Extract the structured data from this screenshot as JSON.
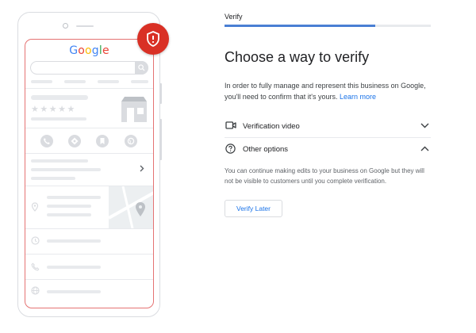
{
  "colors": {
    "accent": "#1a73e8",
    "progress": "#4a7fd4",
    "alert": "#d93025",
    "frame_highlight": "#e57373"
  },
  "illustration": {
    "brand": [
      "G",
      "o",
      "o",
      "g",
      "l",
      "e"
    ],
    "brand_colors": [
      "#4285f4",
      "#ea4335",
      "#fbbc05",
      "#4285f4",
      "#34a853",
      "#ea4335"
    ],
    "stars": "★★★★★",
    "badge_icon": "shield-alert-icon",
    "action_icons": [
      "phone-icon",
      "directions-icon",
      "bookmark-icon",
      "website-icon"
    ],
    "row_icons": [
      "location-pin-icon",
      "clock-icon",
      "phone-icon",
      "globe-icon"
    ]
  },
  "stepper": {
    "label": "Verify",
    "progress": 0.73
  },
  "page": {
    "title": "Choose a way to verify",
    "description": "In order to fully manage and represent this business on Google, you'll need to confirm that it's yours.",
    "learn_more": "Learn more"
  },
  "options": [
    {
      "label": "Verification video",
      "icon": "video-camera-icon",
      "expanded": false
    },
    {
      "label": "Other options",
      "icon": "help-circle-icon",
      "expanded": true
    }
  ],
  "other_options": {
    "note": "You can continue making edits to your business on Google but they will not be visible to customers until you complete verification.",
    "verify_later_label": "Verify Later"
  }
}
